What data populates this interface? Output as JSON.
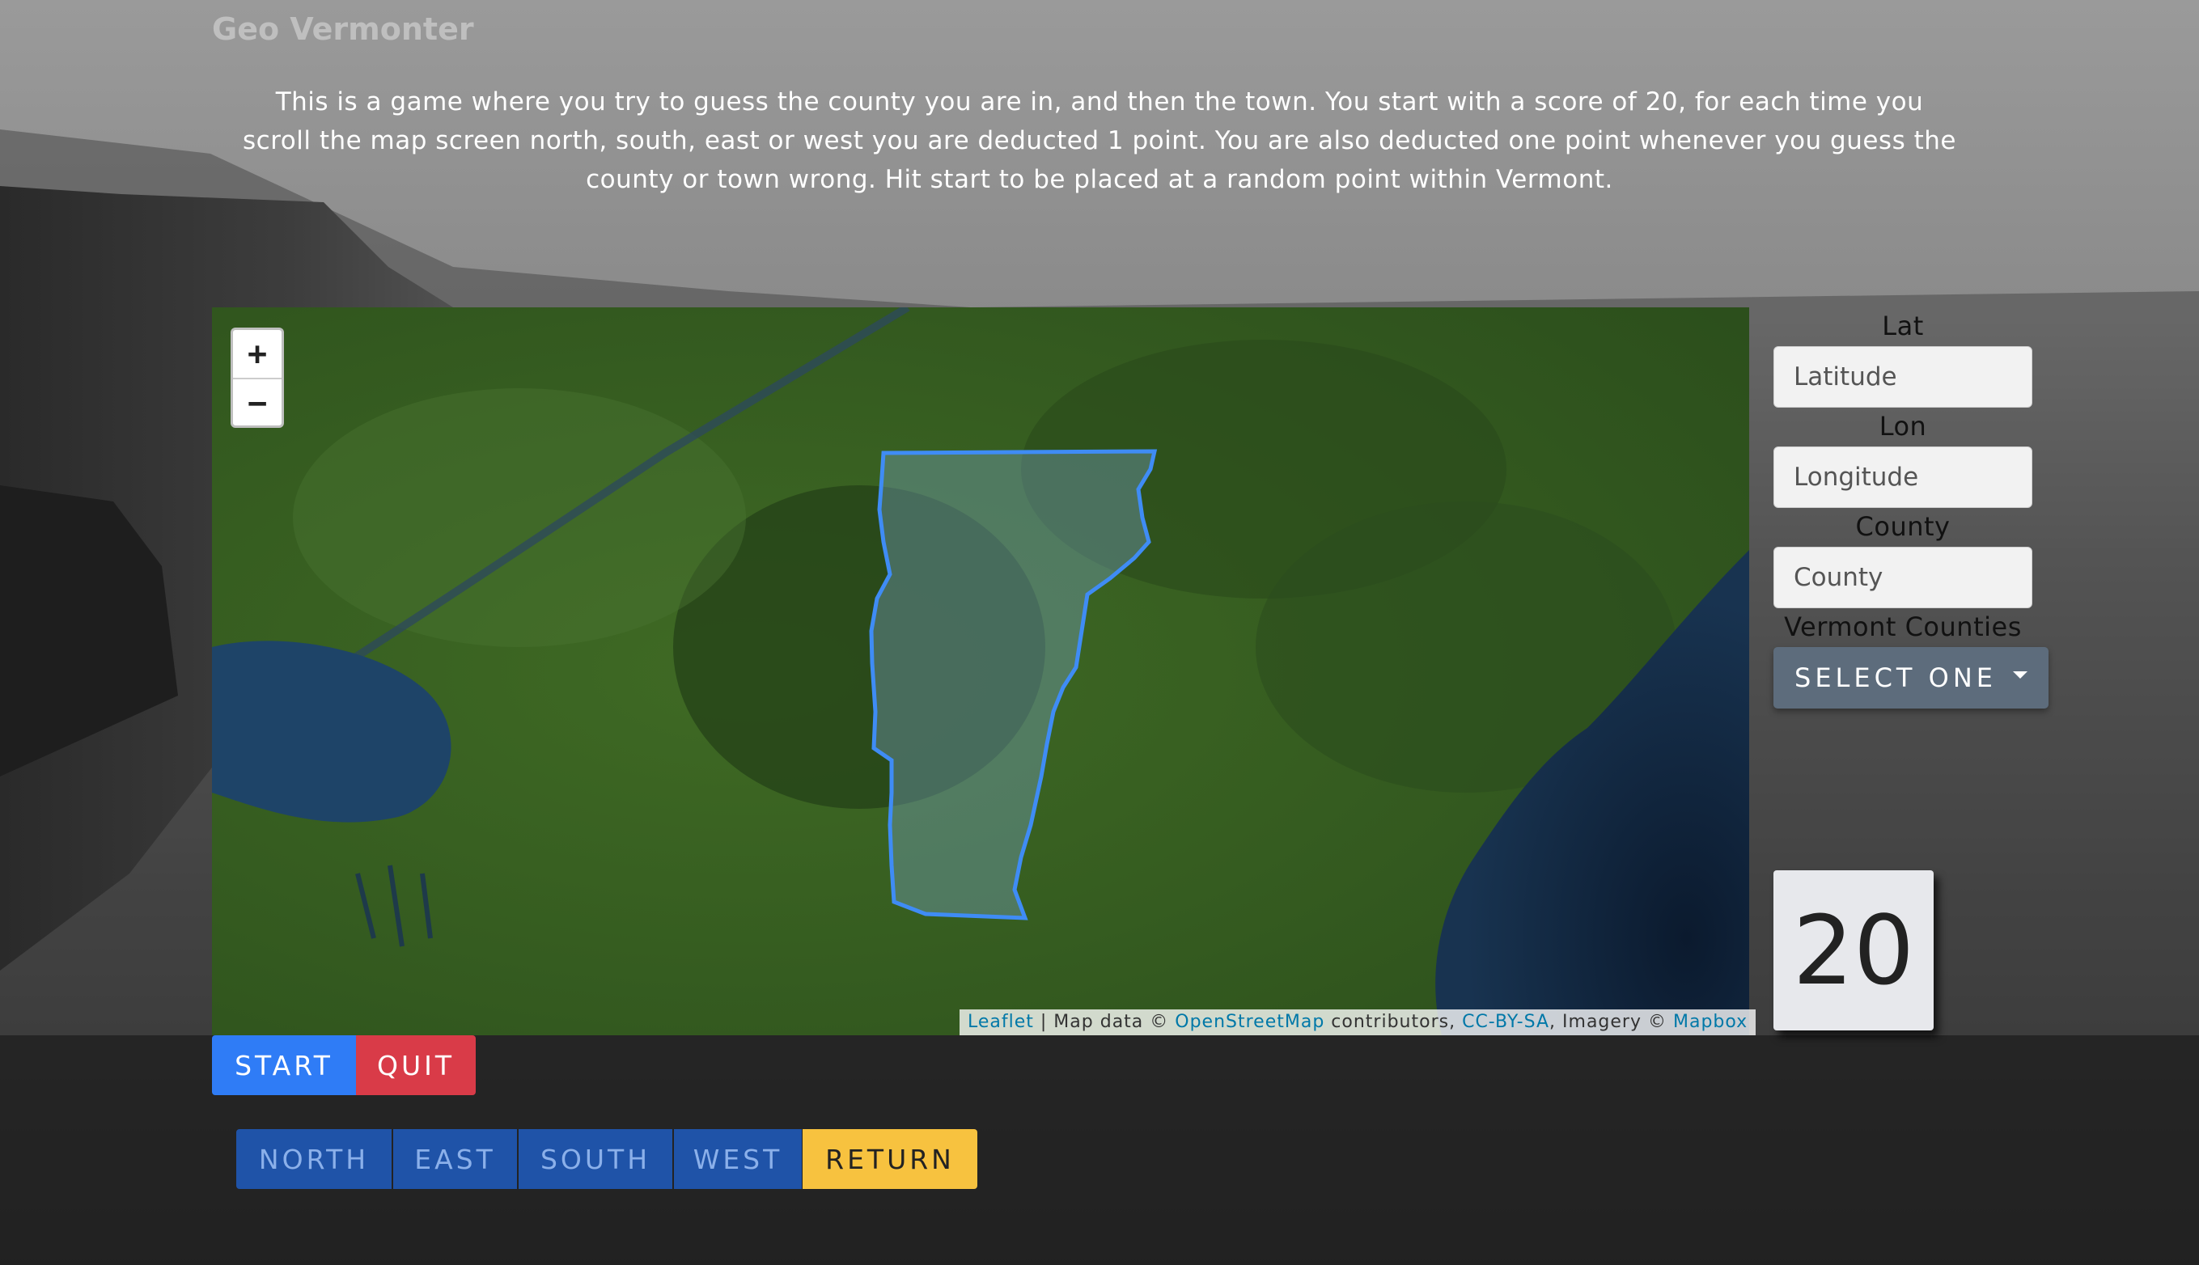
{
  "app": {
    "title": "Geo Vermonter",
    "intro": "This is a game where you try to guess the county you are in, and then the town. You start with a score of 20, for each time you scroll the map screen north, south, east or west you are deducted 1 point. You are also deducted one point whenever you guess the county or town wrong. Hit start to be placed at a random point within Vermont."
  },
  "map": {
    "zoom_in_label": "+",
    "zoom_out_label": "−",
    "attribution": {
      "leaflet": "Leaflet",
      "sep1": " | Map data © ",
      "osm": "OpenStreetMap",
      "sep2": " contributors, ",
      "license": "CC-BY-SA",
      "sep3": ", Imagery © ",
      "mapbox": "Mapbox"
    },
    "outline_color": "#3f8cf5"
  },
  "form": {
    "lat_label": "Lat",
    "lat_placeholder": "Latitude",
    "lon_label": "Lon",
    "lon_placeholder": "Longitude",
    "county_label": "County",
    "county_placeholder": "County",
    "counties_label": "Vermont Counties",
    "select_label": "SELECT ONE"
  },
  "score": {
    "value": "20"
  },
  "controls": {
    "start": "START",
    "quit": "QUIT",
    "north": "NORTH",
    "east": "EAST",
    "south": "SOUTH",
    "west": "WEST",
    "return": "RETURN"
  },
  "colors": {
    "start": "#2f7cf6",
    "quit": "#d93b48",
    "direction": "#1f53a8",
    "return": "#f7c23f",
    "select": "#5d6c7c"
  }
}
